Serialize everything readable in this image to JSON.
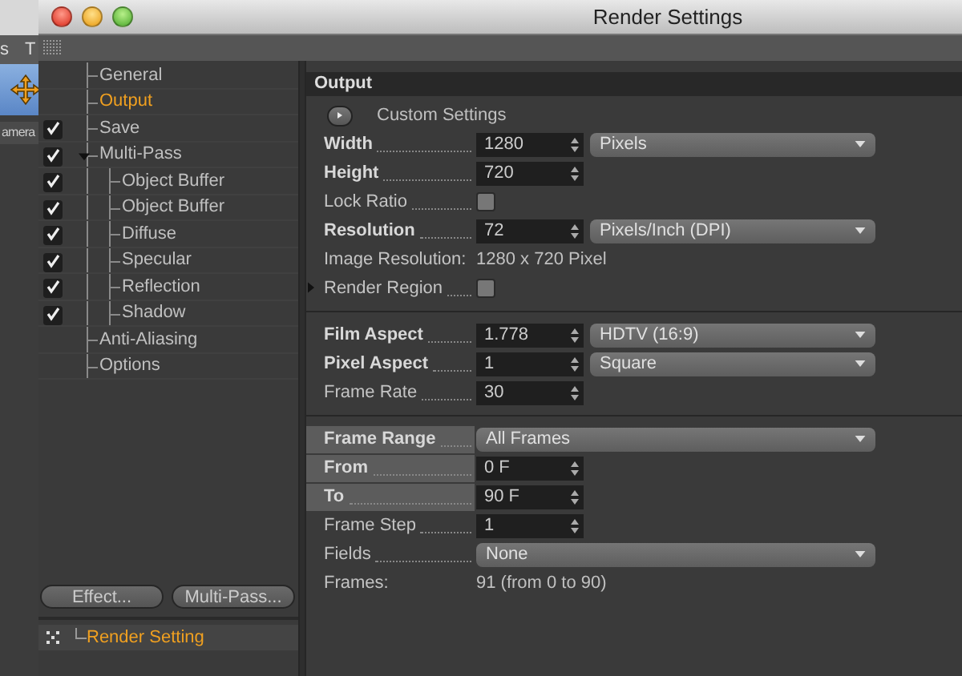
{
  "background_app": {
    "menu_texts": [
      "s",
      "T"
    ],
    "tab_text": "amera"
  },
  "window": {
    "title": "Render Settings"
  },
  "tree": [
    {
      "label": "General",
      "kind": "plain",
      "selected": false
    },
    {
      "label": "Output",
      "kind": "plain",
      "selected": true
    },
    {
      "label": "Save",
      "kind": "toggle",
      "checked": true,
      "selected": false
    },
    {
      "label": "Multi-Pass",
      "kind": "toggle",
      "checked": true,
      "selected": false,
      "expanded": true,
      "children": [
        {
          "label": "Object Buffer",
          "kind": "toggle",
          "checked": true,
          "selected": false
        },
        {
          "label": "Object Buffer",
          "kind": "toggle",
          "checked": true,
          "selected": false
        },
        {
          "label": "Diffuse",
          "kind": "toggle",
          "checked": true,
          "selected": false
        },
        {
          "label": "Specular",
          "kind": "toggle",
          "checked": true,
          "selected": false
        },
        {
          "label": "Reflection",
          "kind": "toggle",
          "checked": true,
          "selected": false
        },
        {
          "label": "Shadow",
          "kind": "toggle",
          "checked": true,
          "selected": false
        }
      ]
    },
    {
      "label": "Anti-Aliasing",
      "kind": "plain",
      "selected": false
    },
    {
      "label": "Options",
      "kind": "plain",
      "selected": false
    }
  ],
  "sidebar_buttons": [
    "Effect...",
    "Multi-Pass..."
  ],
  "render_settings_list": [
    {
      "label": "Render Setting",
      "selected": true
    }
  ],
  "panel": {
    "title": "Output",
    "rows": [
      {
        "kind": "action",
        "label": "Custom Settings"
      },
      {
        "kind": "number",
        "label": "Width",
        "strong": true,
        "value": "1280",
        "dropdown": "Pixels"
      },
      {
        "kind": "number",
        "label": "Height",
        "strong": true,
        "value": "720"
      },
      {
        "kind": "checkbox",
        "label": "Lock Ratio",
        "checked": false
      },
      {
        "kind": "number",
        "label": "Resolution",
        "strong": true,
        "value": "72",
        "dropdown": "Pixels/Inch (DPI)"
      },
      {
        "kind": "info",
        "label": "Image Resolution:",
        "value": "1280 x 720 Pixel"
      },
      {
        "kind": "checkbox",
        "label": "Render Region",
        "checked": false,
        "expanded": false
      },
      {
        "kind": "divider"
      },
      {
        "kind": "number",
        "label": "Film Aspect",
        "strong": true,
        "value": "1.778",
        "dropdown": "HDTV (16:9)"
      },
      {
        "kind": "number",
        "label": "Pixel Aspect",
        "strong": true,
        "value": "1",
        "dropdown": "Square"
      },
      {
        "kind": "number",
        "label": "Frame Rate",
        "value": "30"
      },
      {
        "kind": "divider"
      },
      {
        "kind": "select",
        "label": "Frame Range",
        "strong": true,
        "highlighted": true,
        "dropdown": "All Frames"
      },
      {
        "kind": "number",
        "label": "From",
        "strong": true,
        "highlighted": true,
        "value": "0 F"
      },
      {
        "kind": "number",
        "label": "To",
        "strong": true,
        "highlighted": true,
        "value": "90 F"
      },
      {
        "kind": "number",
        "label": "Frame Step",
        "value": "1"
      },
      {
        "kind": "select",
        "label": "Fields",
        "dropdown": "None"
      },
      {
        "kind": "info",
        "label": "Frames:",
        "value": "91 (from 0 to 90)"
      }
    ]
  }
}
